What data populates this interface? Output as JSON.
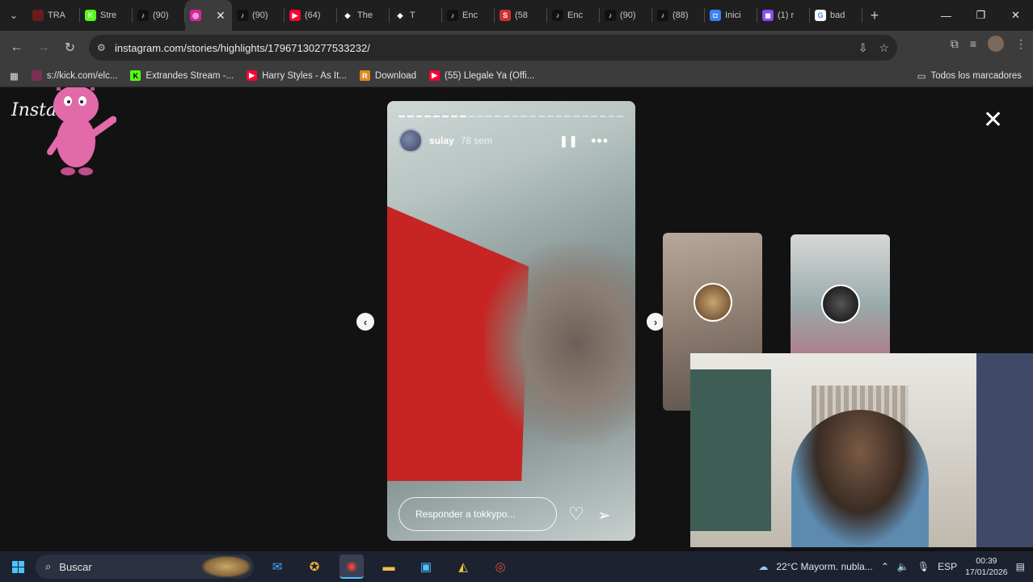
{
  "tabs": [
    {
      "label": "TRA",
      "fav_color": "#6b1b1b",
      "fav": ""
    },
    {
      "label": "Stre",
      "fav_color": "#53fc18",
      "fav": "K"
    },
    {
      "label": "(90)",
      "fav_color": "#111111",
      "fav": "♪"
    },
    {
      "label": "",
      "fav_color": "#d6249f",
      "fav": "◎",
      "active": true
    },
    {
      "label": "(90)",
      "fav_color": "#111111",
      "fav": "♪"
    },
    {
      "label": "(64)",
      "fav_color": "#ff0033",
      "fav": "▶"
    },
    {
      "label": "The",
      "fav_color": "#222222",
      "fav": "◆"
    },
    {
      "label": "T",
      "fav_color": "#222222",
      "fav": "◆"
    },
    {
      "label": "Enc",
      "fav_color": "#111111",
      "fav": "♪"
    },
    {
      "label": "(58",
      "fav_color": "#d32f2f",
      "fav": "S"
    },
    {
      "label": "Enc",
      "fav_color": "#111111",
      "fav": "♪"
    },
    {
      "label": "(90)",
      "fav_color": "#111111",
      "fav": "♪"
    },
    {
      "label": "(88)",
      "fav_color": "#111111",
      "fav": "♪"
    },
    {
      "label": "Inici",
      "fav_color": "#3b82f6",
      "fav": "◘"
    },
    {
      "label": "(1) r",
      "fav_color": "#9146ff",
      "fav": "◼"
    },
    {
      "label": "bad",
      "fav_color": "#ffffff",
      "fav": "G"
    }
  ],
  "address": {
    "url": "instagram.com/stories/highlights/17967130277533232/"
  },
  "bookmarks": [
    {
      "label": "s://kick.com/elc...",
      "fav_color": "#7a3050",
      "fav": ""
    },
    {
      "label": "Extrandes Stream -...",
      "fav_color": "#53fc18",
      "fav": "K"
    },
    {
      "label": "Harry Styles - As It...",
      "fav_color": "#ff0033",
      "fav": "▶"
    },
    {
      "label": "Download",
      "fav_color": "#e08a1e",
      "fav": "R"
    },
    {
      "label": "(55) Llegale Ya (Offi...",
      "fav_color": "#ff0033",
      "fav": "▶"
    }
  ],
  "bookmarks_all": "Todos los marcadores",
  "instagram": {
    "logo": "Insta",
    "story": {
      "username": "sulay",
      "time": "78 sem",
      "reply_placeholder": "Responder a tokkypo...",
      "segments_total": 26,
      "segments_done": 8
    }
  },
  "taskbar": {
    "search": "Buscar",
    "weather": "22°C  Mayorm. nubla...",
    "lang": "ESP",
    "time": "00:39",
    "date": "17/01/2026"
  }
}
